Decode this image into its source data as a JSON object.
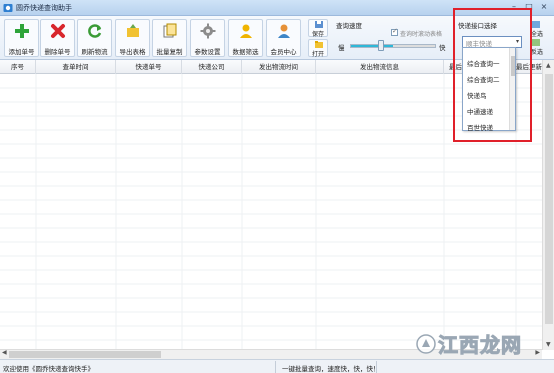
{
  "window": {
    "title": "圆乔快递查询助手",
    "controls": [
      "–",
      "□",
      "×"
    ]
  },
  "toolbar": {
    "buttons": [
      {
        "label": "添加单号",
        "icon": "add-icon"
      },
      {
        "label": "删除单号",
        "icon": "delete-icon"
      },
      {
        "label": "刷新物流",
        "icon": "refresh-icon"
      },
      {
        "label": "导出表格",
        "icon": "export-icon"
      },
      {
        "label": "批量复制",
        "icon": "copy-icon"
      },
      {
        "label": "参数设置",
        "icon": "gear-icon"
      },
      {
        "label": "数据筛选",
        "icon": "filter-icon"
      },
      {
        "label": "会员中心",
        "icon": "member-icon"
      }
    ],
    "save_label": "保存",
    "open_label": "打开"
  },
  "speed": {
    "title": "查询速度",
    "auto_scroll_label": "查询时滚动表格",
    "auto_scroll_checked": true,
    "slow_label": "慢",
    "fast_label": "快",
    "level": 0.5
  },
  "api": {
    "title": "快递接口选择",
    "selected": "顺丰快递",
    "options": [
      "综合查询一",
      "综合查询二",
      "快递鸟",
      "中通速递",
      "百世快递"
    ],
    "select_all_label": "全选",
    "invert_label": "反选"
  },
  "table": {
    "columns": [
      "序号",
      "查单时间",
      "快递单号",
      "快递公司",
      "发出物流时间",
      "发出物流信息",
      "最后",
      "最后更新物流"
    ]
  },
  "status": {
    "left": "欢迎使用《圆乔快递查询快手》",
    "middle": "一键批量查询，速度快，快，快！"
  },
  "watermark": {
    "text": "江西龙网"
  },
  "colors": {
    "highlight": "#e0202a",
    "slider_fill": "#2fb7d7"
  }
}
